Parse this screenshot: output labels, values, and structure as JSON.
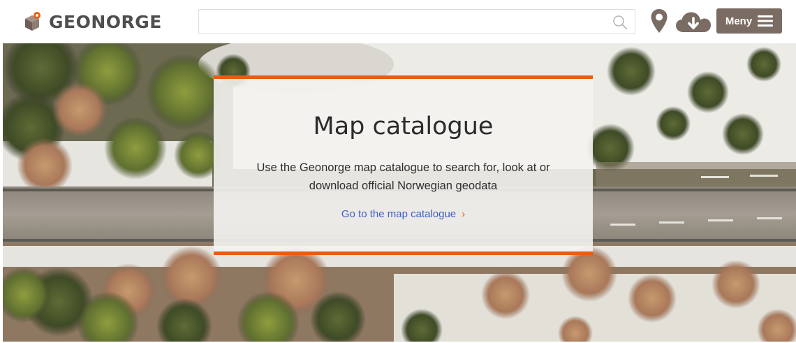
{
  "header": {
    "logo_text": "GEONORGE",
    "search": {
      "value": "",
      "placeholder": ""
    },
    "menu_label": "Meny",
    "icons": [
      "geonorge-logo-icon",
      "search-icon",
      "map-pin-icon",
      "cloud-download-icon",
      "hamburger-icon"
    ]
  },
  "hero": {
    "title": "Map catalogue",
    "description": "Use the Geonorge map catalogue to search for, look at or download official Norwegian geodata",
    "link_label": "Go to the map catalogue",
    "link_chevron": "›"
  },
  "colors": {
    "accent": "#ee5a10",
    "menu_button": "#7a6b63",
    "link": "#3c5fc4",
    "logo_text": "#4f4f4f"
  }
}
